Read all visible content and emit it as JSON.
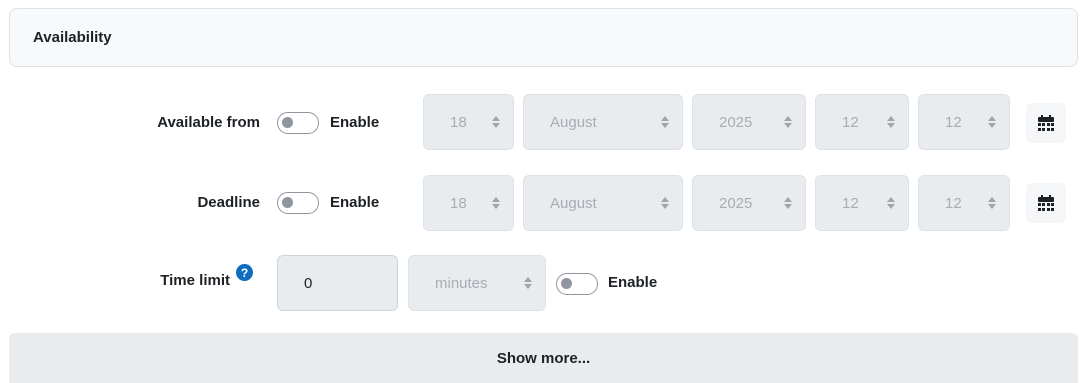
{
  "section": {
    "title": "Availability"
  },
  "available_from": {
    "label": "Available from",
    "enable_label": "Enable",
    "enabled": false,
    "day": "18",
    "month": "August",
    "year": "2025",
    "hour": "12",
    "minute": "12",
    "calendar_icon": "calendar-icon"
  },
  "deadline": {
    "label": "Deadline",
    "enable_label": "Enable",
    "enabled": false,
    "day": "18",
    "month": "August",
    "year": "2025",
    "hour": "12",
    "minute": "12",
    "calendar_icon": "calendar-icon"
  },
  "time_limit": {
    "label": "Time limit",
    "help_icon": "question-circle-icon",
    "help_glyph": "?",
    "value": "0",
    "unit": "minutes",
    "enable_label": "Enable",
    "enabled": false
  },
  "show_more_label": "Show more...",
  "colors": {
    "accent": "#0f6cbf",
    "disabled_field": "#e9ecef",
    "text": "#1d2125"
  }
}
